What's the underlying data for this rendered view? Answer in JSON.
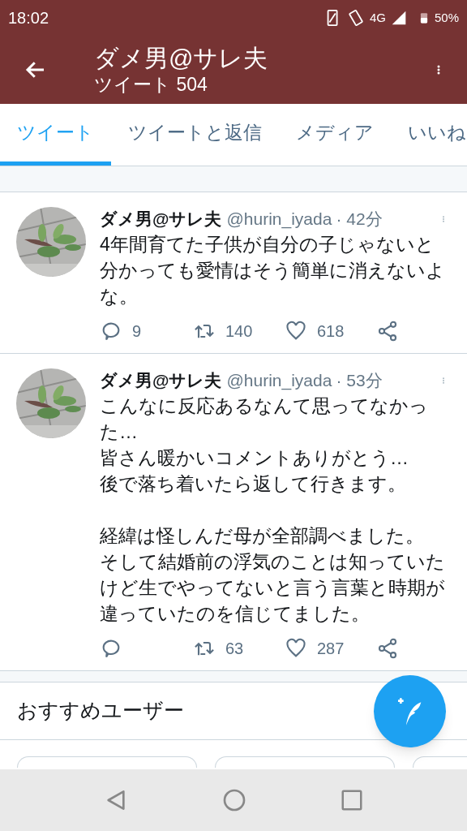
{
  "status_bar": {
    "time": "18:02",
    "network": "4G",
    "battery": "50%"
  },
  "header": {
    "title": "ダメ男@サレ夫",
    "subtitle": "ツイート 504"
  },
  "tabs": [
    {
      "label": "ツイート",
      "selected": true
    },
    {
      "label": "ツイートと返信",
      "selected": false
    },
    {
      "label": "メディア",
      "selected": false
    },
    {
      "label": "いいね",
      "selected": false
    }
  ],
  "tweets": [
    {
      "name": "ダメ男@サレ夫",
      "handle": "@hurin_iyada",
      "time": "· 42分",
      "paragraphs": [
        [
          "4年間育てた子供が自分の子じゃないと分かっても愛情はそう簡単に消えないよな。"
        ]
      ],
      "replies": "9",
      "retweets": "140",
      "likes": "618"
    },
    {
      "name": "ダメ男@サレ夫",
      "handle": "@hurin_iyada",
      "time": "· 53分",
      "paragraphs": [
        [
          "こんなに反応あるなんて思ってなかった…",
          "皆さん暖かいコメントありがとう…",
          "後で落ち着いたら返して行きます。"
        ],
        [
          "経緯は怪しんだ母が全部調べました。",
          "そして結婚前の浮気のことは知っていたけど生でやってないと言う言葉と時期が違っていたのを信じてました。"
        ]
      ],
      "retweets": "63",
      "likes": "287"
    }
  ],
  "recommended": {
    "title": "おすすめユーザー"
  }
}
